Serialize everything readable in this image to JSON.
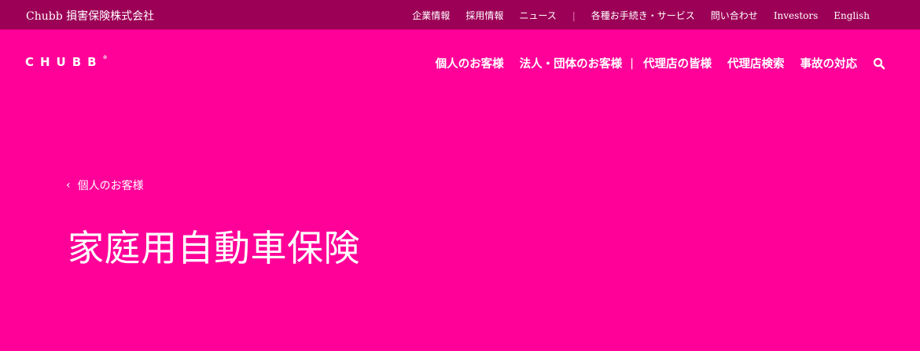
{
  "topbar": {
    "company": "Chubb 損害保険株式会社",
    "links": [
      "企業情報",
      "採用情報",
      "ニュース"
    ],
    "separator": "|",
    "links2": [
      "各種お手続き・サービス",
      "問い合わせ",
      "Investors",
      "English"
    ]
  },
  "brand": {
    "logo_text": "CHUBB",
    "logo_mark": "®"
  },
  "nav": {
    "items": [
      "個人のお客様",
      "法人・団体のお客様"
    ],
    "separator": "|",
    "items2": [
      "代理店の皆様",
      "代理店検索",
      "事故の対応"
    ],
    "search_icon": "search-icon"
  },
  "breadcrumb": {
    "chevron": "‹",
    "label": "個人のお客様"
  },
  "page": {
    "title": "家庭用自動車保険"
  },
  "colors": {
    "hero_bg": "#ff0099",
    "topbar_bg": "#9c0056",
    "text": "#ffffff"
  }
}
